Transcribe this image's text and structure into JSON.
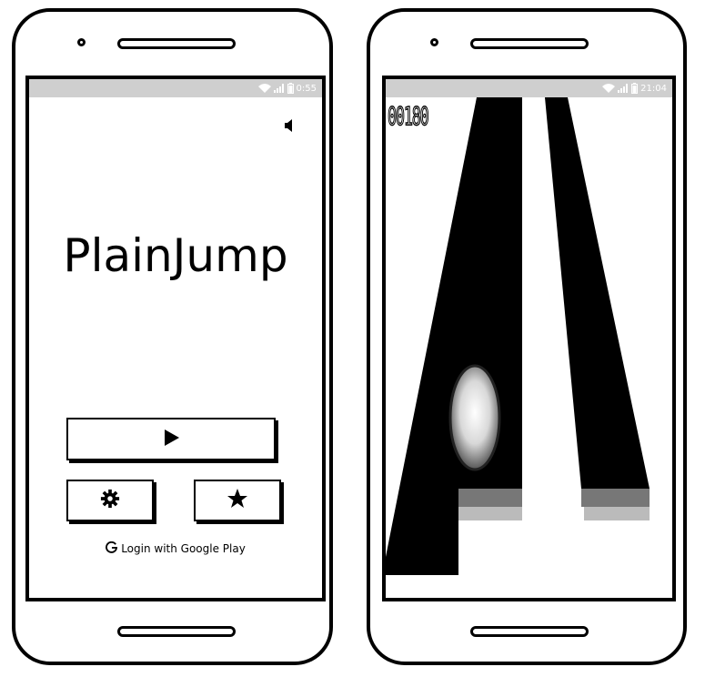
{
  "left_phone": {
    "status_bar": {
      "time": "0:55"
    },
    "game_title": "PlainJump",
    "buttons": {
      "play_icon": "play-icon",
      "settings_icon": "gear-icon",
      "achievements_icon": "star-icon"
    },
    "login_text": "Login with Google Play",
    "sound_icon": "speaker-icon"
  },
  "right_phone": {
    "status_bar": {
      "time": "21:04"
    },
    "score": "00180"
  }
}
